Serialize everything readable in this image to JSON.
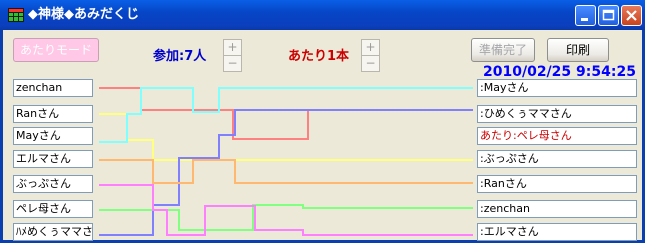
{
  "window": {
    "title": "◆神様◆あみだくじ",
    "icon": "grid-app-icon",
    "controls": [
      "minimize-icon",
      "maximize-icon",
      "close-icon"
    ]
  },
  "toolbar": {
    "hit_mode_label": "あたりモード",
    "participants_label": "参加:7人",
    "winners_label": "あたり1本",
    "plus": "+",
    "minus": "−",
    "ready_label": "準備完了",
    "print_label": "印刷"
  },
  "datetime": "2010/02/25 9:54:25",
  "participants": [
    "zenchan",
    "Ranさん",
    "Mayさん",
    "エルマさん",
    "ぶっぷさん",
    "ペレ母さん",
    "ﾊﾒめくぅママさん"
  ],
  "results": [
    {
      "text": ":Mayさん",
      "color": "#000000"
    },
    {
      "text": ":ひめくぅママさん",
      "color": "#000000"
    },
    {
      "text": "あたり:ペレ母さん",
      "color": "#cc0000"
    },
    {
      "text": ":ぶっぷさん",
      "color": "#000000"
    },
    {
      "text": ":Ranさん",
      "color": "#000000"
    },
    {
      "text": ":zenchan",
      "color": "#000000"
    },
    {
      "text": ":エルマさん",
      "color": "#000000"
    }
  ],
  "lane_colors": [
    "#ff8080",
    "#ffff80",
    "#80ffff",
    "#8080ff",
    "#ffb870",
    "#80ff80",
    "#ff80ff"
  ],
  "colors": {
    "participants_label": "#0000cc",
    "winners_label": "#cc0000",
    "datetime": "#0000ff",
    "titlebar": "#0a4fd8"
  }
}
